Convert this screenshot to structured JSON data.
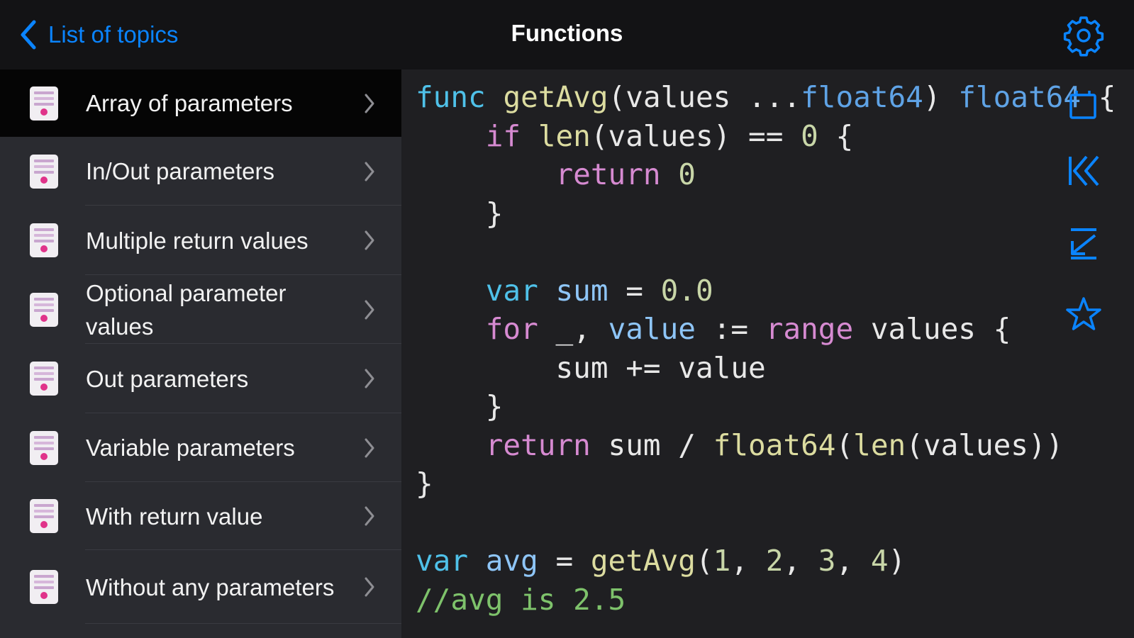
{
  "navbar": {
    "back_label": "List of topics",
    "title": "Functions"
  },
  "sidebar": {
    "items": [
      {
        "label": "Array of parameters",
        "selected": true
      },
      {
        "label": "In/Out parameters"
      },
      {
        "label": "Multiple return values"
      },
      {
        "label": "Optional parameter values"
      },
      {
        "label": "Out parameters"
      },
      {
        "label": "Variable parameters"
      },
      {
        "label": "With return value"
      },
      {
        "label": "Without any parameters"
      }
    ]
  },
  "code": {
    "language": "go",
    "lines": [
      "func getAvg(values ...float64) float64 {",
      "    if len(values) == 0 {",
      "        return 0",
      "    }",
      "",
      "    var sum = 0.0",
      "    for _, value := range values {",
      "        sum += value",
      "    }",
      "    return sum / float64(len(values))",
      "}",
      "",
      "var avg = getAvg(1, 2, 3, 4)",
      "//avg is 2.5"
    ]
  },
  "icons": {
    "back": "chevron-left-icon",
    "settings": "gear-icon",
    "toolbar": [
      "copy-icon",
      "jump-to-start-icon",
      "collapse-icon",
      "star-icon"
    ]
  },
  "colors": {
    "accent": "#0a84ff",
    "navbar_bg": "#131315",
    "sidebar_bg": "#2a2b30",
    "sidebar_selected_bg": "#050505",
    "code_bg": "#1f1f22"
  }
}
